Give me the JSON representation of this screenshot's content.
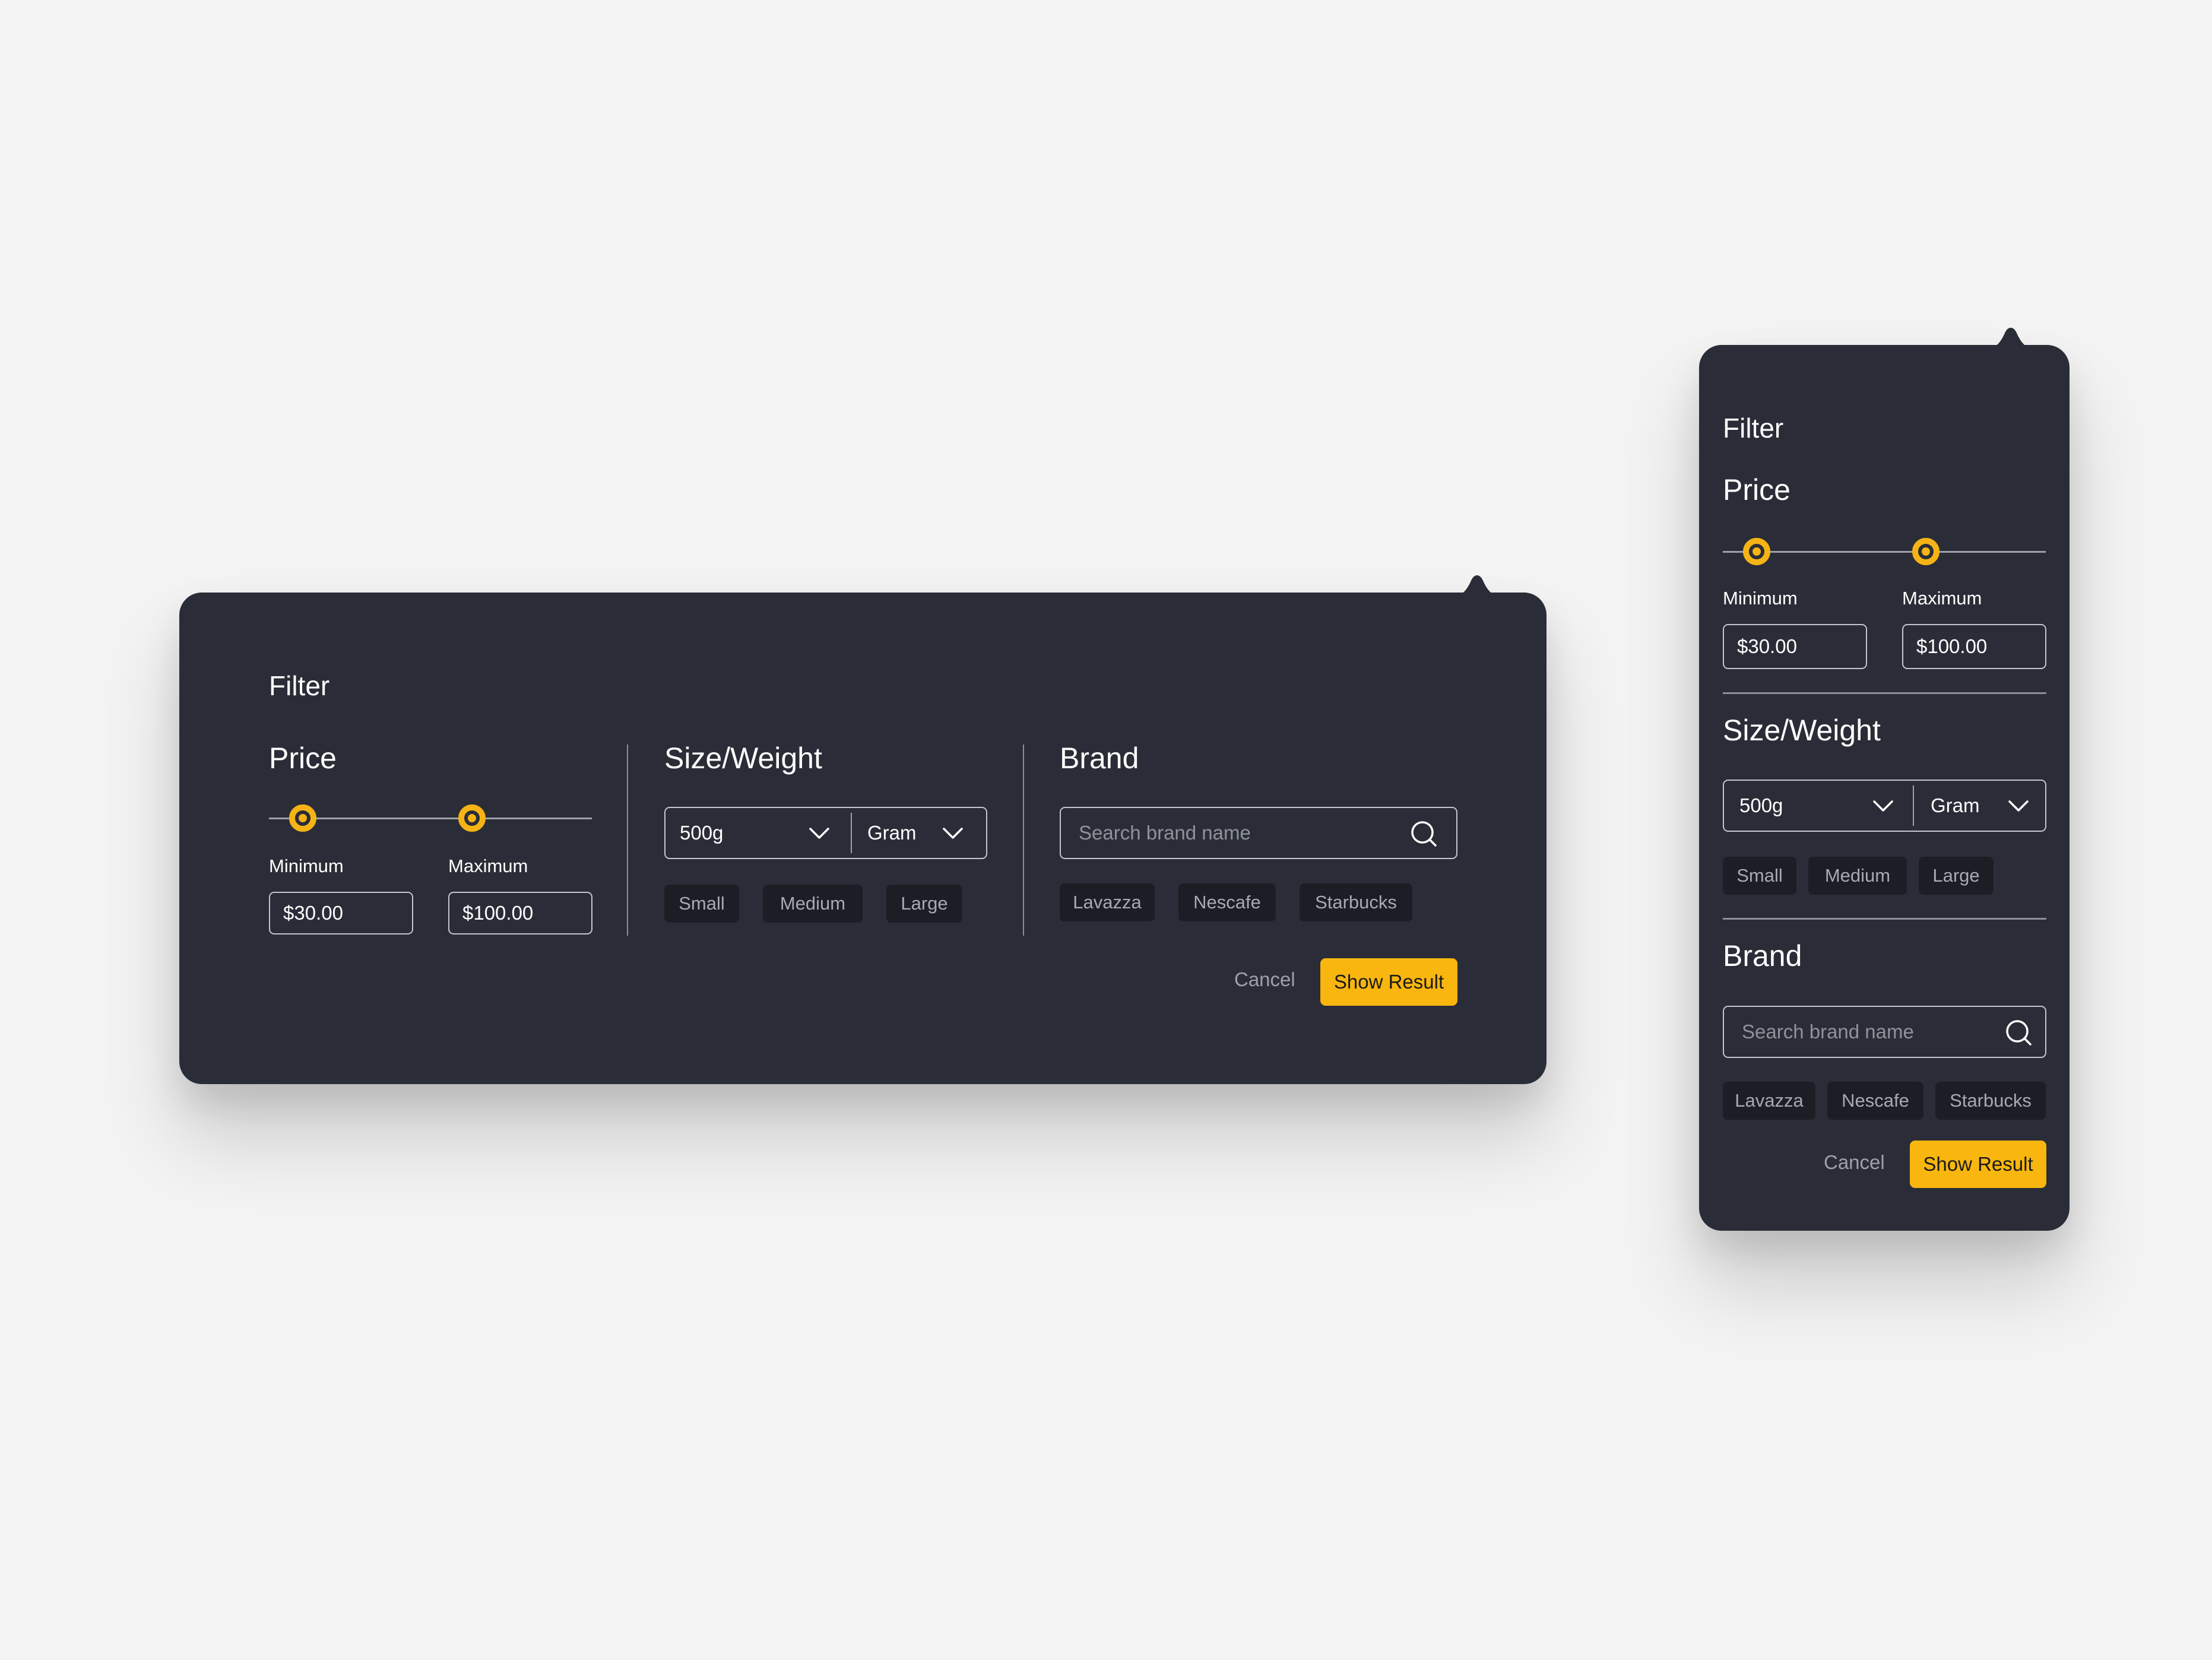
{
  "colors": {
    "background": "#f3f3f3",
    "panel": "#2a2d37",
    "accent": "#f8b60e",
    "chip": "#1c1e26",
    "divider": "#8c8f98",
    "muted_text": "#9ea1a9"
  },
  "filter": {
    "title": "Filter",
    "price": {
      "heading": "Price",
      "min_label": "Minimum",
      "max_label": "Maximum",
      "min_value": "$30.00",
      "max_value": "$100.00"
    },
    "size": {
      "heading": "Size/Weight",
      "weight_value": "500g",
      "unit_value": "Gram",
      "chips": [
        "Small",
        "Medium",
        "Large"
      ]
    },
    "brand": {
      "heading": "Brand",
      "search_placeholder": "Search brand name",
      "chips": [
        "Lavazza",
        "Nescafe",
        "Starbucks"
      ]
    },
    "actions": {
      "cancel": "Cancel",
      "submit": "Show Result"
    }
  },
  "icons": [
    "chevron-down-icon",
    "search-icon"
  ]
}
